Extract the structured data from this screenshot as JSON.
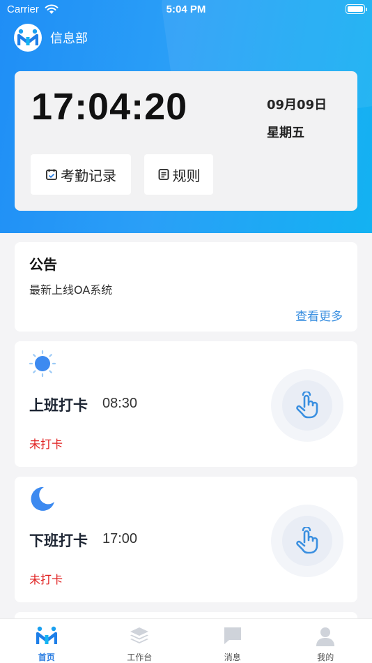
{
  "status_bar": {
    "carrier": "Carrier",
    "time": "5:04 PM",
    "wifi_icon": "wifi-icon",
    "battery_icon": "battery-icon"
  },
  "header": {
    "department": "信息部",
    "logo_icon": "app-logo-icon"
  },
  "clock_card": {
    "time": "17:04:20",
    "date": "09月09日",
    "weekday": "星期五",
    "records_label": "考勤记录",
    "rules_label": "规则"
  },
  "notice": {
    "title": "公告",
    "content": "最新上线OA系统",
    "more_label": "查看更多"
  },
  "punch_in": {
    "label": "上班打卡",
    "time": "08:30",
    "status": "未打卡",
    "icon": "sun-icon"
  },
  "punch_out": {
    "label": "下班打卡",
    "time": "17:00",
    "status": "未打卡",
    "icon": "moon-icon"
  },
  "tabs": [
    {
      "label": "首页",
      "icon": "home-logo-icon",
      "active": true
    },
    {
      "label": "工作台",
      "icon": "layers-icon",
      "active": false
    },
    {
      "label": "消息",
      "icon": "message-icon",
      "active": false
    },
    {
      "label": "我的",
      "icon": "user-icon",
      "active": false
    }
  ],
  "colors": {
    "primary": "#2a9ff7",
    "status_red": "#e02020",
    "link": "#3a8fe0"
  }
}
